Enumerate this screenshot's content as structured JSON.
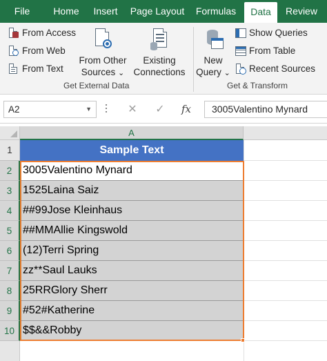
{
  "tabs": [
    {
      "id": "file",
      "label": "File"
    },
    {
      "id": "home",
      "label": "Home"
    },
    {
      "id": "insert",
      "label": "Insert"
    },
    {
      "id": "page_layout",
      "label": "Page Layout"
    },
    {
      "id": "formulas",
      "label": "Formulas"
    },
    {
      "id": "data",
      "label": "Data",
      "active": true
    },
    {
      "id": "review",
      "label": "Review"
    }
  ],
  "ribbon": {
    "get_external_data": {
      "from_access": "From Access",
      "from_web": "From Web",
      "from_text": "From Text",
      "from_other_sources_line1": "From Other",
      "from_other_sources_line2": "Sources",
      "existing_connections_line1": "Existing",
      "existing_connections_line2": "Connections",
      "group_label": "Get External Data"
    },
    "get_transform": {
      "new_query_line1": "New",
      "new_query_line2": "Query",
      "show_queries": "Show Queries",
      "from_table": "From Table",
      "recent_sources": "Recent Sources",
      "group_label": "Get & Transform"
    },
    "dropdown_glyph": "⌄"
  },
  "formula_bar": {
    "name_box": "A2",
    "cancel_glyph": "✕",
    "enter_glyph": "✓",
    "fx_glyph": "fx",
    "content": "3005Valentino Mynard"
  },
  "grid": {
    "column_header": "A",
    "row_numbers": [
      "1",
      "2",
      "3",
      "4",
      "5",
      "6",
      "7",
      "8",
      "9",
      "10"
    ],
    "header_cell": "Sample Text",
    "cells": [
      "3005Valentino Mynard",
      "1525Laina Saiz",
      "##99Jose Kleinhaus",
      "##MMAllie Kingswold",
      "(12)Terri Spring",
      "zz**Saul Lauks",
      "25RRGlory Sherr",
      "#52#Katherine",
      "$$&&Robby"
    ]
  },
  "colors": {
    "excel_green": "#217346",
    "table_header": "#4472c4",
    "selection_border": "#ed7d31",
    "selection_fill": "#d3d3d3"
  }
}
